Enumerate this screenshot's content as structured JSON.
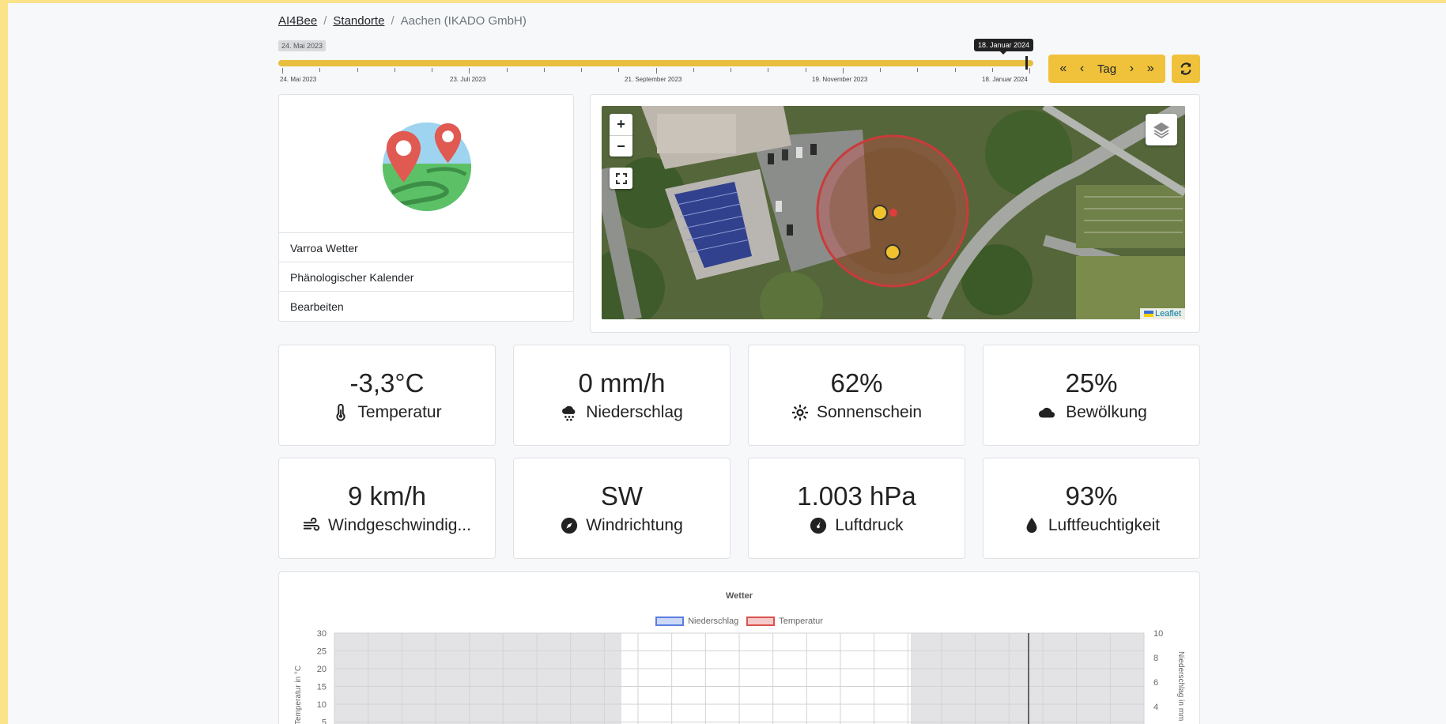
{
  "breadcrumb": {
    "root": "AI4Bee",
    "level1": "Standorte",
    "current": "Aachen (IKADO GmbH)",
    "sep": "/"
  },
  "timeline": {
    "start_label": "24. Mai 2023",
    "current_label": "18. Januar 2024",
    "tick_labels": [
      "24. Mai 2023",
      "23. Juli 2023",
      "21. September 2023",
      "19. November 2023",
      "18. Januar 2024"
    ],
    "progress_fraction": 0.99
  },
  "nav": {
    "first": "«",
    "prev": "‹",
    "period": "Tag",
    "next": "›",
    "last": "»"
  },
  "location": {
    "menu": [
      "Varroa Wetter",
      "Phänologischer Kalender",
      "Bearbeiten"
    ]
  },
  "map": {
    "zoom_in": "+",
    "zoom_out": "−",
    "attribution": "Leaflet"
  },
  "stats": [
    {
      "value": "-3,3°C",
      "label": "Temperatur",
      "icon": "thermometer-icon"
    },
    {
      "value": "0 mm/h",
      "label": "Niederschlag",
      "icon": "cloud-rain-icon"
    },
    {
      "value": "62%",
      "label": "Sonnenschein",
      "icon": "sun-icon"
    },
    {
      "value": "25%",
      "label": "Bewölkung",
      "icon": "cloud-icon"
    },
    {
      "value": "9 km/h",
      "label": "Windgeschwindig...",
      "icon": "wind-icon"
    },
    {
      "value": "SW",
      "label": "Windrichtung",
      "icon": "compass-icon"
    },
    {
      "value": "1.003 hPa",
      "label": "Luftdruck",
      "icon": "gauge-icon"
    },
    {
      "value": "93%",
      "label": "Luftfeuchtigkeit",
      "icon": "droplet-icon"
    }
  ],
  "colors": {
    "accent": "#f0c23b",
    "precip": "#5b7fe0",
    "temp": "#d9534f"
  },
  "chart_data": {
    "type": "line",
    "title": "Wetter",
    "legend": [
      "Niederschlag",
      "Temperatur"
    ],
    "ylabel": "Temperatur in °C",
    "ylabel_right": "Niederschlag in mm",
    "y_ticks": [
      "30",
      "25",
      "20",
      "15",
      "10",
      "5"
    ],
    "y2_ticks": [
      "10",
      "8",
      "6",
      "4"
    ],
    "ylim": [
      0,
      30
    ],
    "y2lim": [
      0,
      10
    ],
    "grid": true
  }
}
